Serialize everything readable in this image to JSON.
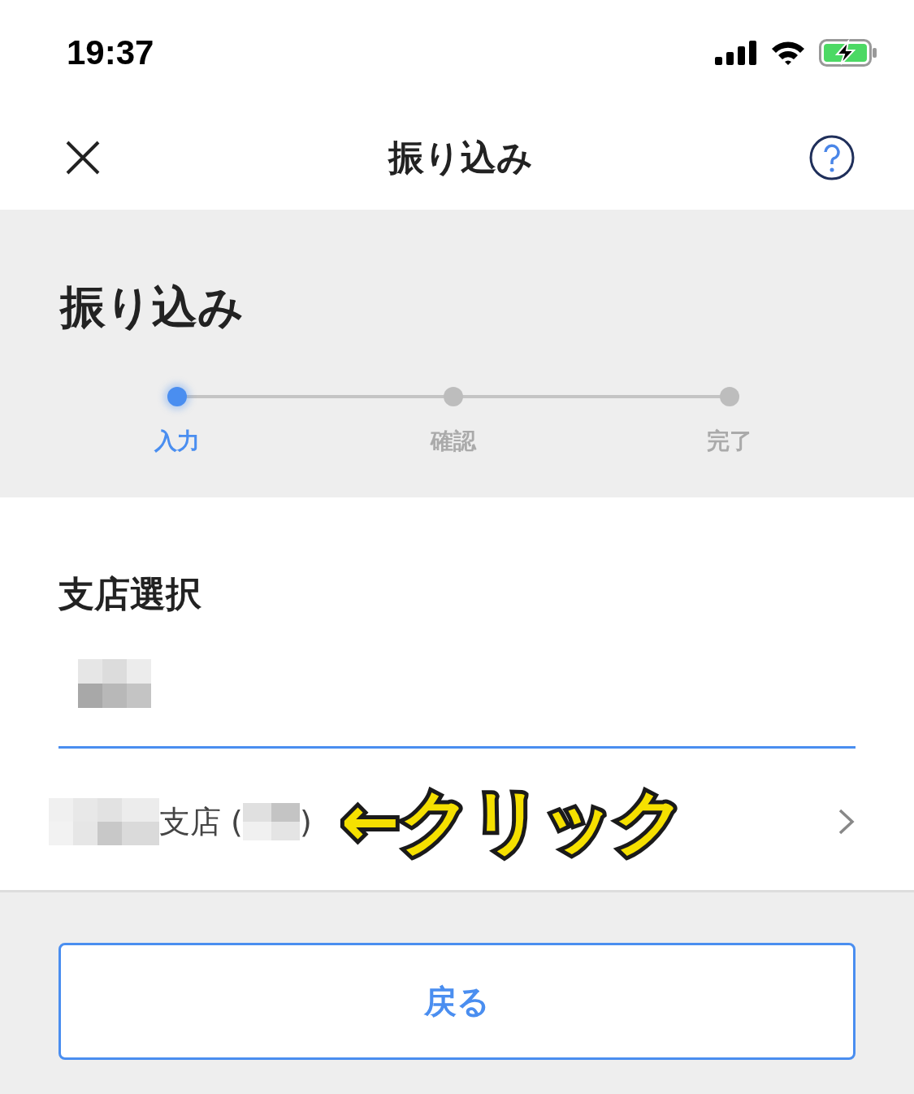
{
  "status_bar": {
    "time": "19:37"
  },
  "header": {
    "title": "振り込み"
  },
  "page_title": "振り込み",
  "steps": [
    {
      "label": "入力",
      "selected": true
    },
    {
      "label": "確認",
      "selected": false
    },
    {
      "label": "完了",
      "selected": false
    }
  ],
  "branch": {
    "label": "支店選択",
    "row_text": "支店 (",
    "row_close": ")"
  },
  "annotation": "←クリック",
  "back_button": "戻る"
}
